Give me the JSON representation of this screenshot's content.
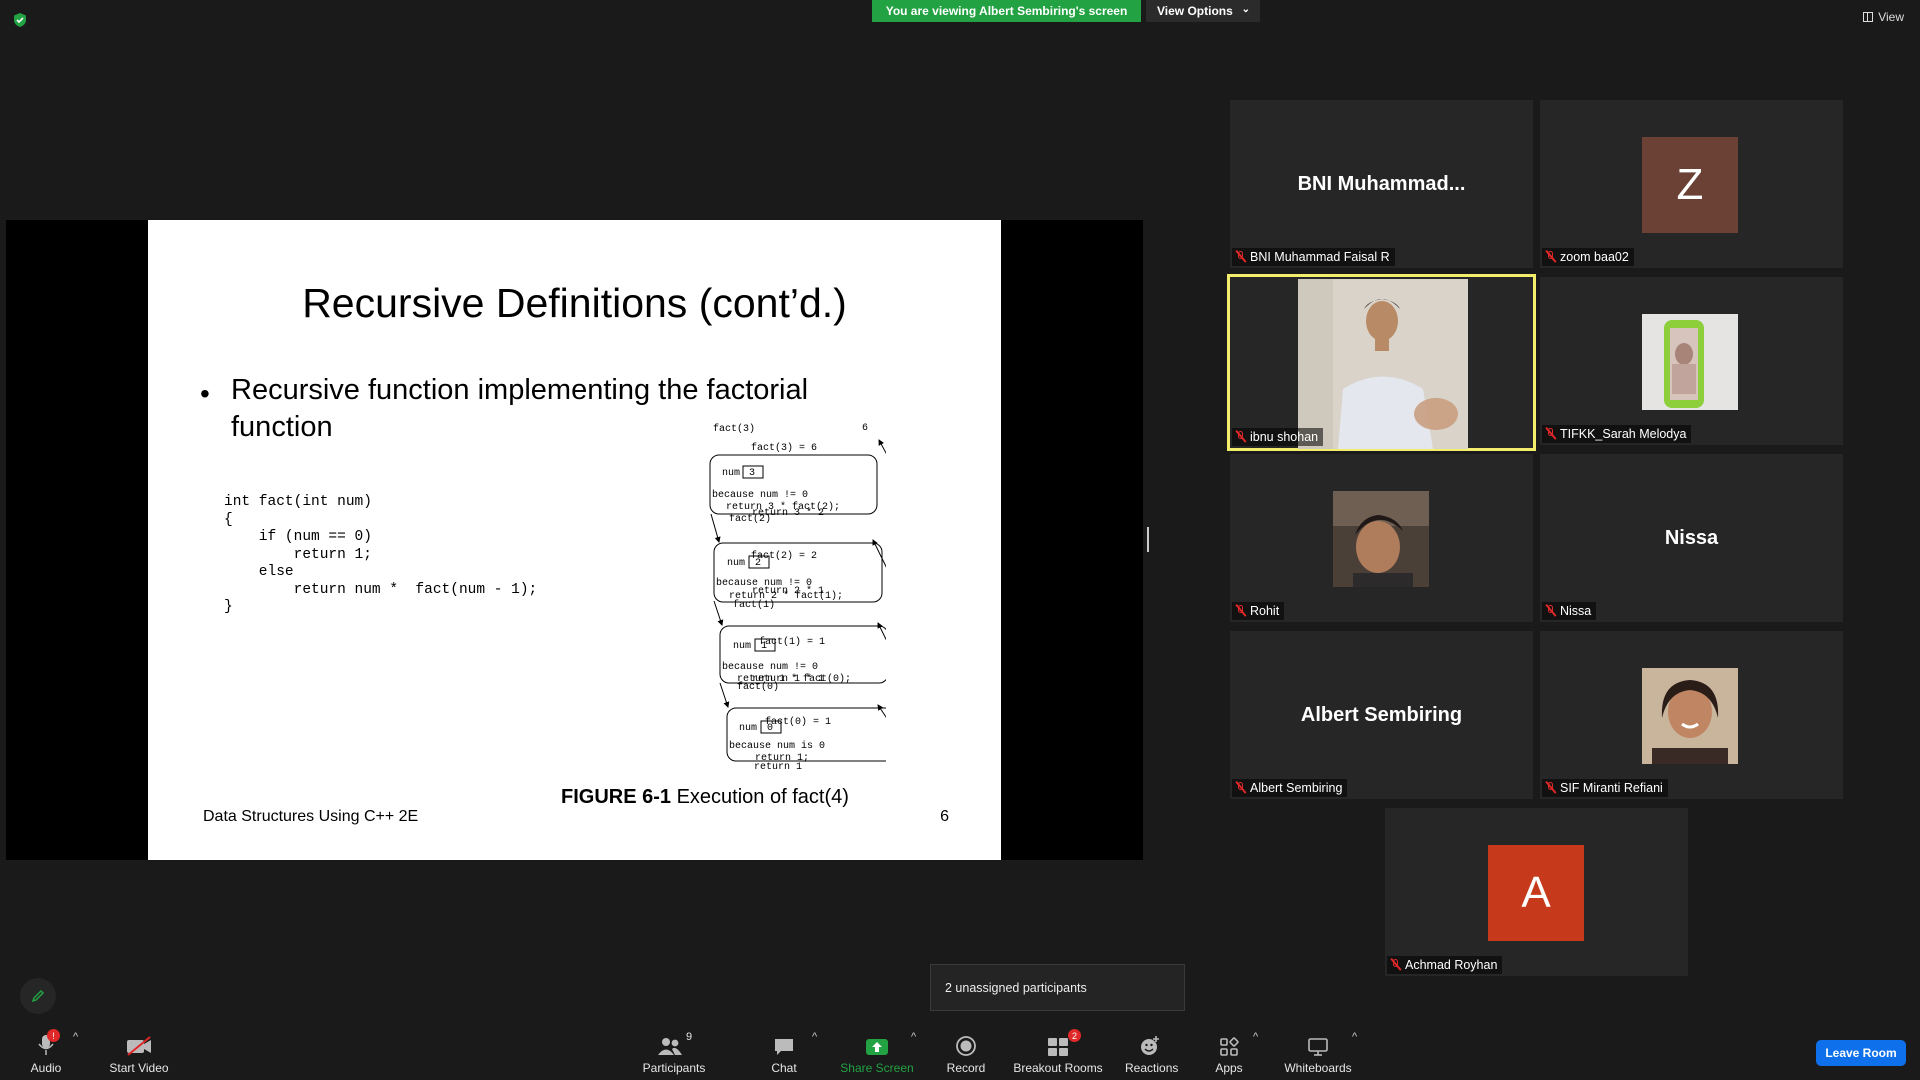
{
  "top": {
    "banner": "You are viewing Albert Sembiring's screen",
    "view_options": "View Options",
    "view": "View"
  },
  "slide": {
    "title": "Recursive Definitions (cont’d.)",
    "bullet_line1": "Recursive function implementing the factorial",
    "bullet_line2": "function",
    "code": "int fact(int num)\n{\n    if (num == 0)\n        return 1;\n    else\n        return num *  fact(num - 1);\n}",
    "figure_label": "FIGURE 6-1",
    "figure_caption": " Execution of fact(4)",
    "footer_left": "Data Structures Using C++ 2E",
    "footer_page": "6",
    "diagram": {
      "top_value": "6",
      "frames": [
        {
          "call": "fact(3)",
          "num": "3",
          "cond": "because num != 0",
          "ret": "return 3 * fact(2);"
        },
        {
          "call": "fact(2)",
          "num": "2",
          "cond": "because num != 0",
          "ret": "return 2 * fact(1);"
        },
        {
          "call": "fact(1)",
          "num": "1",
          "cond": "because num != 0",
          "ret": "return 1 * fact(0);"
        },
        {
          "call": "fact(0)",
          "num": "0",
          "cond": "because num is 0",
          "ret": "return 1;"
        }
      ],
      "num_label": "num",
      "right_results": [
        "fact(3) = 6",
        "fact(2) = 2",
        "fact(1) = 1",
        "fact(0) = 1"
      ],
      "right_returns": [
        "return 3 * 2",
        "return 2 * 1",
        "return 1 * 1",
        "return 1"
      ]
    }
  },
  "participants": [
    {
      "display": "BNI  Muhammad...",
      "label": "BNI Muhammad Faisal R",
      "kind": "name"
    },
    {
      "display": "Z",
      "label": "zoom baa02",
      "kind": "letter",
      "color": "#6b4136"
    },
    {
      "display": "",
      "label": "ibnu shohan",
      "kind": "video",
      "active": true
    },
    {
      "display": "",
      "label": "TIFKK_Sarah Melodya",
      "kind": "photo"
    },
    {
      "display": "",
      "label": "Rohit",
      "kind": "photo"
    },
    {
      "display": "Nissa",
      "label": "Nissa",
      "kind": "name"
    },
    {
      "display": "Albert Sembiring",
      "label": "Albert Sembiring",
      "kind": "name"
    },
    {
      "display": "",
      "label": "SIF Miranti Refiani",
      "kind": "photo"
    },
    {
      "display": "A",
      "label": "Achmad Royhan",
      "kind": "letter",
      "color": "#c6391a"
    }
  ],
  "tooltip": "2 unassigned participants",
  "toolbar": {
    "audio": "Audio",
    "audio_badge": "!",
    "start_video": "Start Video",
    "participants": "Participants",
    "participants_count": "9",
    "chat": "Chat",
    "share_screen": "Share Screen",
    "record": "Record",
    "breakout_rooms": "Breakout Rooms",
    "breakout_badge": "2",
    "reactions": "Reactions",
    "apps": "Apps",
    "whiteboards": "Whiteboards",
    "leave": "Leave Room"
  },
  "colors": {
    "share_green": "#23a243",
    "leave_blue": "#0e71eb",
    "active_speaker": "#f2ee6c",
    "muted_red": "#e02828"
  }
}
